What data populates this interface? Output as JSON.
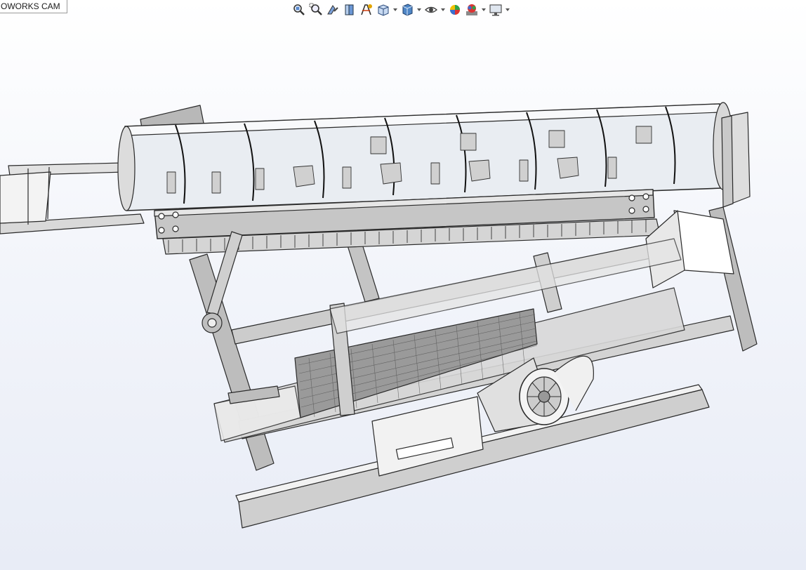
{
  "tab": {
    "label": "OWORKS CAM"
  },
  "toolbar": {
    "tools": [
      {
        "icon": "zoom-to-fit-icon"
      },
      {
        "icon": "zoom-to-area-icon"
      },
      {
        "icon": "previous-view-icon"
      },
      {
        "icon": "section-view-icon"
      },
      {
        "icon": "dynamic-annotation-icon"
      },
      {
        "icon": "view-orientation-icon",
        "dropdown": true
      },
      {
        "icon": "display-style-icon",
        "dropdown": true
      },
      {
        "icon": "hide-show-items-icon",
        "dropdown": true
      },
      {
        "icon": "edit-appearance-icon"
      },
      {
        "icon": "apply-scene-icon",
        "dropdown": true
      },
      {
        "icon": "view-settings-icon",
        "dropdown": true
      }
    ]
  },
  "model": {
    "description_icon": "cad-assembly-model"
  }
}
